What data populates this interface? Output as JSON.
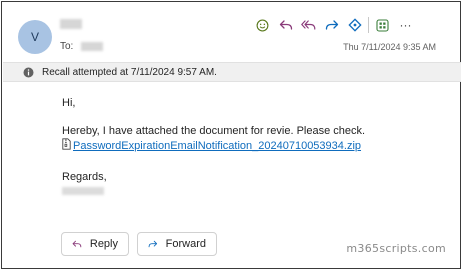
{
  "sender": {
    "avatar_initial": "V"
  },
  "recipient": {
    "to_label": "To:"
  },
  "timestamp": "Thu 7/11/2024 9:35 AM",
  "toolbar": {
    "icons": [
      "emoji-icon",
      "reply-icon",
      "reply-all-icon",
      "forward-icon",
      "loop-icon",
      "apps-icon",
      "more-icon"
    ],
    "more_label": "···",
    "accent": "#0f6cbd",
    "emoji_color": "#5b7a1f",
    "apps_color": "#3a7d3a"
  },
  "recall_bar": {
    "text": "Recall attempted at 7/11/2024 9:57 AM."
  },
  "message": {
    "greeting": "Hi,",
    "body_line": "Hereby, I have attached the document for revie. Please check.",
    "attachment_name": "PasswordExpirationEmailNotification_20240710053934.zip",
    "closing": "Regards,"
  },
  "actions": {
    "reply_label": "Reply",
    "forward_label": "Forward"
  },
  "watermark": "m365scripts.com"
}
